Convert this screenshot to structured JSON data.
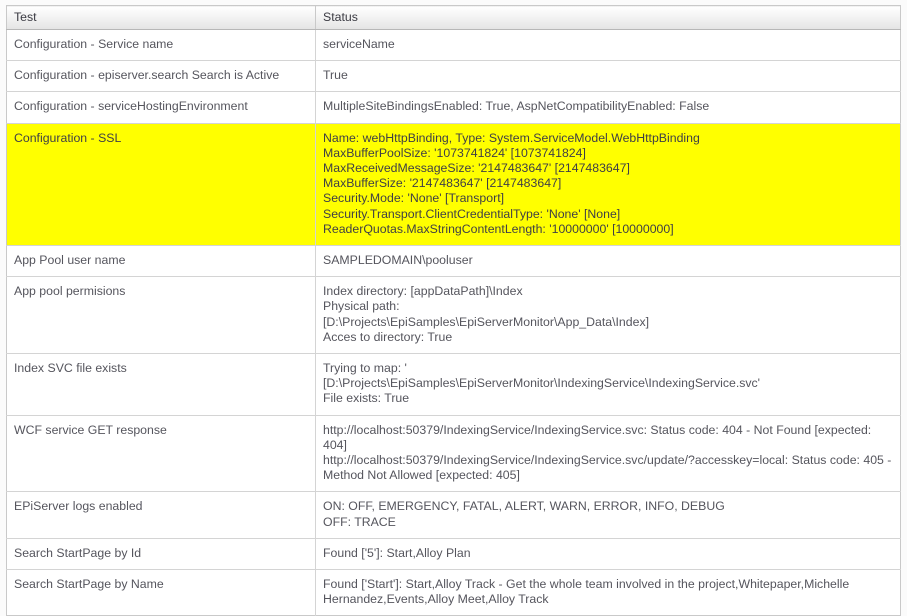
{
  "table": {
    "columns": [
      {
        "key": "test",
        "label": "Test"
      },
      {
        "key": "status",
        "label": "Status"
      }
    ],
    "rows": [
      {
        "test": "Configuration - Service name",
        "status": "serviceName",
        "highlight": false
      },
      {
        "test": "Configuration - episerver.search Search is Active",
        "status": "True",
        "highlight": false
      },
      {
        "test": "Configuration - serviceHostingEnvironment",
        "status": "MultipleSiteBindingsEnabled: True, AspNetCompatibilityEnabled: False",
        "highlight": false
      },
      {
        "test": "Configuration - SSL",
        "status": "Name: webHttpBinding, Type: System.ServiceModel.WebHttpBinding\nMaxBufferPoolSize: '1073741824' [1073741824]\nMaxReceivedMessageSize: '2147483647' [2147483647]\nMaxBufferSize: '2147483647' [2147483647]\nSecurity.Mode: 'None' [Transport]\nSecurity.Transport.ClientCredentialType: 'None' [None]\nReaderQuotas.MaxStringContentLength: '10000000' [10000000]",
        "highlight": true
      },
      {
        "test": "App Pool user name",
        "status": "SAMPLEDOMAIN\\pooluser",
        "highlight": false
      },
      {
        "test": "App pool permisions",
        "status": "Index directory: [appDataPath]\\Index\nPhysical path:\n[D:\\Projects\\EpiSamples\\EpiServerMonitor\\App_Data\\Index]\nAcces to directory: True",
        "highlight": false
      },
      {
        "test": "Index SVC file exists",
        "status": "Trying to map: '\n[D:\\Projects\\EpiSamples\\EpiServerMonitor\\IndexingService\\IndexingService.svc'\nFile exists: True",
        "highlight": false
      },
      {
        "test": "WCF service GET response",
        "status": "http://localhost:50379/IndexingService/IndexingService.svc: Status code: 404 - Not Found [expected: 404]\nhttp://localhost:50379/IndexingService/IndexingService.svc/update/?accesskey=local: Status code: 405 - Method Not Allowed [expected: 405]",
        "highlight": false
      },
      {
        "test": "EPiServer logs enabled",
        "status": "ON: OFF, EMERGENCY, FATAL, ALERT, WARN, ERROR, INFO, DEBUG\nOFF: TRACE",
        "highlight": false
      },
      {
        "test": "Search StartPage by Id",
        "status": "Found ['5']: Start,Alloy Plan",
        "highlight": false
      },
      {
        "test": "Search StartPage by Name",
        "status": "Found ['Start']: Start,Alloy Track - Get the whole team involved in the project,Whitepaper,Michelle Hernandez,Events,Alloy Meet,Alloy Track",
        "highlight": false
      }
    ]
  },
  "colors": {
    "highlight": "#ffff00",
    "text": "#55555d",
    "border": "#d4d4d4",
    "header_border": "#c9c9c9",
    "page_background": "#fbfbfb"
  }
}
